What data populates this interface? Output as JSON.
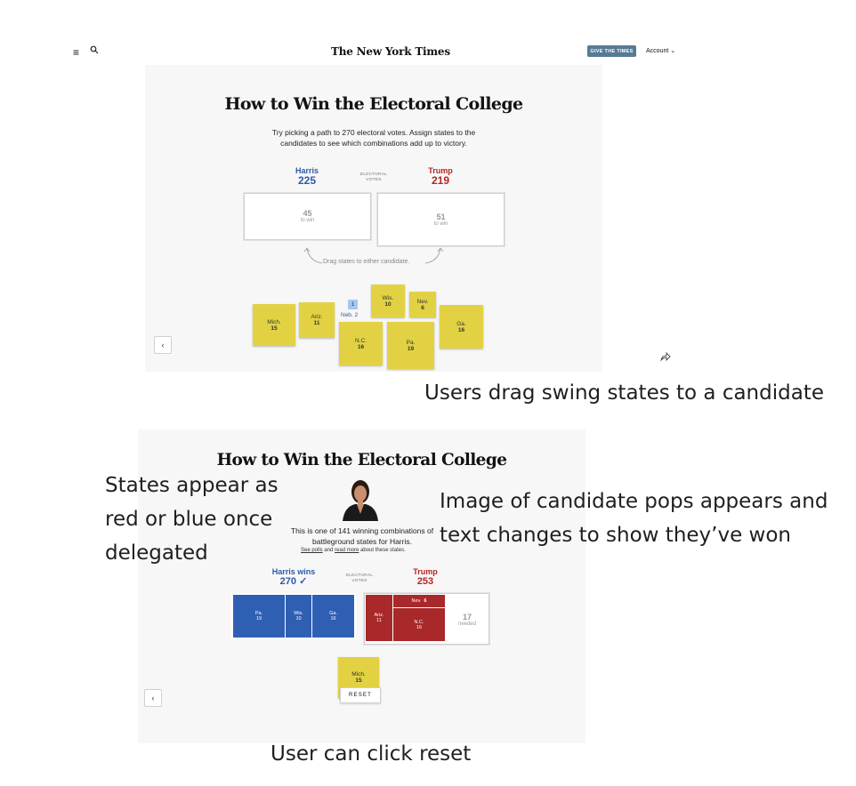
{
  "nyt": {
    "masthead": "The New York Times",
    "give_button": "GIVE THE TIMES",
    "account": "Account ⌄",
    "menu_icon": "≡"
  },
  "panel1": {
    "title": "How to Win the Electoral College",
    "intro": "Try picking a path to 270 electoral votes. Assign states to the candidates to see which combinations add up to victory.",
    "harris": {
      "name": "Harris",
      "votes": "225"
    },
    "trump": {
      "name": "Trump",
      "votes": "219"
    },
    "ev_label_1": "ELECTORAL",
    "ev_label_2": "VOTES",
    "harris_towin": {
      "n": "45",
      "t": "to win"
    },
    "trump_towin": {
      "n": "51",
      "t": "to win"
    },
    "hint": "Drag states to either candidate.",
    "states": [
      {
        "name": "Mich.",
        "value": "15"
      },
      {
        "name": "Ariz.",
        "value": "11"
      },
      {
        "name": "Wis.",
        "value": "10"
      },
      {
        "name": "Nev.",
        "value": "6"
      },
      {
        "name": "N.C.",
        "value": "16"
      },
      {
        "name": "Pa.",
        "value": "19"
      },
      {
        "name": "Ga.",
        "value": "16"
      }
    ],
    "neb": {
      "box": "1",
      "label": "Neb. 2"
    },
    "back": "‹"
  },
  "panel2": {
    "title": "How to Win the Electoral College",
    "result_line1": "This is one of 141 winning combinations of",
    "result_line2": "battleground states for Harris.",
    "link_polls": "See polls",
    "link_and": "and",
    "link_more": "read more",
    "link_tail": "about these states.",
    "harris": {
      "name": "Harris wins",
      "votes": "270 ✓"
    },
    "trump": {
      "name": "Trump",
      "votes": "253"
    },
    "ev_label_1": "ELECTORAL",
    "ev_label_2": "VOTES",
    "blue_states": [
      {
        "name": "Pa.",
        "value": "19"
      },
      {
        "name": "Wis.",
        "value": "10"
      },
      {
        "name": "Ga.",
        "value": "16"
      }
    ],
    "red_states": [
      {
        "name": "Ariz.",
        "value": "11"
      },
      {
        "name": "Nev.",
        "value": "6"
      },
      {
        "name": "N.C.",
        "value": "16"
      }
    ],
    "needed": {
      "n": "17",
      "t": "needed"
    },
    "leftover": {
      "name": "Mich.",
      "value": "15"
    },
    "reset": "RESET",
    "back": "‹"
  },
  "annotations": {
    "drag": "Users drag swing states to a candidate",
    "states_1": "States appear as",
    "states_2": "red or blue once",
    "states_3": "delegated",
    "image_1": "Image of candidate pops appears and",
    "image_2": "text changes to show they’ve won",
    "reset": "User can click reset"
  },
  "colors": {
    "harris_blue": "#2d5aa8",
    "trump_red": "#b42424",
    "swing_yellow": "#e2d243",
    "panel_bg": "#f7f7f7"
  }
}
